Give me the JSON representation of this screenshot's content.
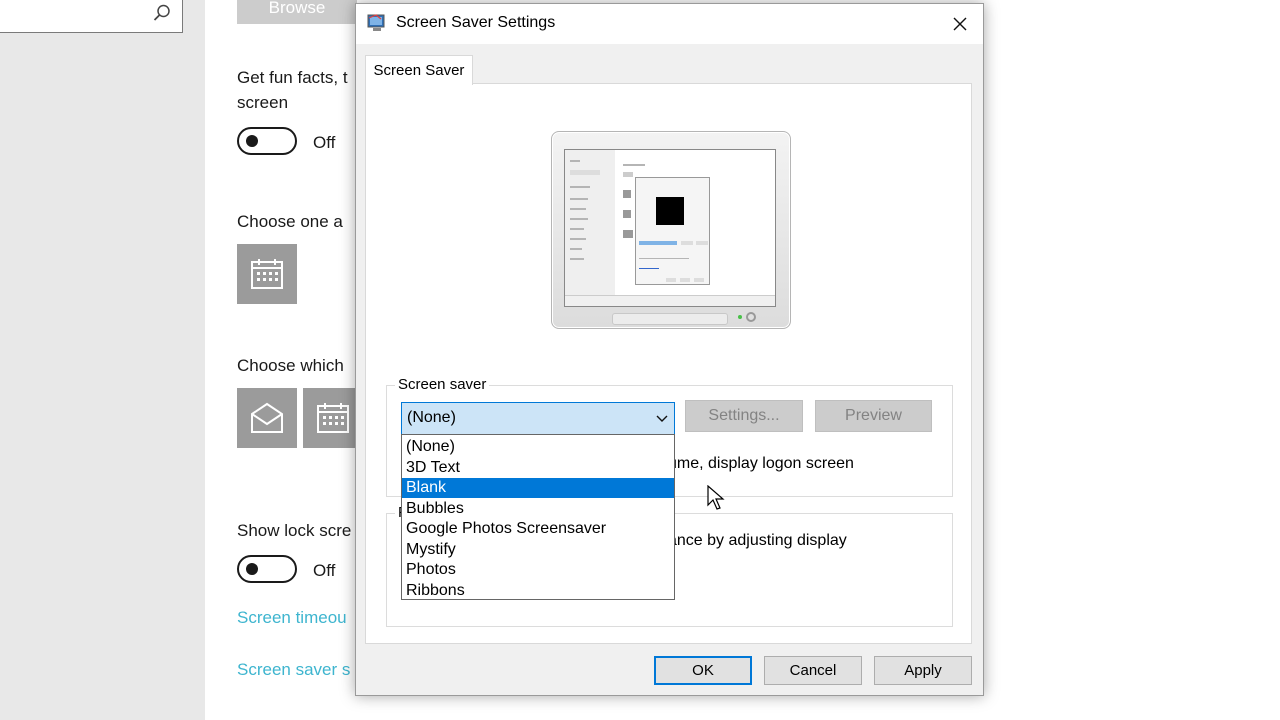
{
  "settings_page": {
    "browse_label": "Browse",
    "fun_facts_label_line1": "Get fun facts, t",
    "fun_facts_label_line2": "screen",
    "fun_facts_state": "Off",
    "choose_one_label": "Choose one a",
    "choose_which_label": "Choose which",
    "show_lock_label": "Show lock scre",
    "show_lock_state": "Off",
    "screen_timeout_link": "Screen timeou",
    "screen_saver_link": "Screen saver s"
  },
  "dialog": {
    "title": "Screen Saver Settings",
    "tab_label": "Screen Saver",
    "screen_saver_group_label": "Screen saver",
    "selected_saver": "(None)",
    "settings_button": "Settings...",
    "preview_button": "Preview",
    "resume_text": "ume, display logon screen",
    "power_group_label": "P",
    "power_text": "ance by adjusting display",
    "dropdown_options": [
      "(None)",
      "3D Text",
      "Blank",
      "Bubbles",
      "Google Photos Screensaver",
      "Mystify",
      "Photos",
      "Ribbons"
    ],
    "highlighted_option": "Blank",
    "ok_button": "OK",
    "cancel_button": "Cancel",
    "apply_button": "Apply"
  },
  "icons": {
    "search": "search-icon",
    "close": "close-icon",
    "app": "screen-saver-app-icon",
    "chevron": "chevron-down-icon",
    "calendar": "calendar-icon",
    "mail": "mail-icon",
    "cursor": "mouse-cursor-icon"
  },
  "colors": {
    "accent": "#0078d7",
    "link_settings": "#3eb5cf",
    "tile_gray": "#9b9b9b"
  }
}
